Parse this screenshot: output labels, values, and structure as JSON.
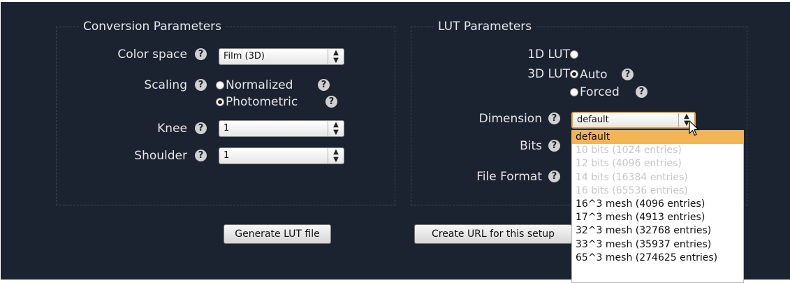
{
  "conversion": {
    "legend": "Conversion Parameters",
    "color_space": {
      "label": "Color space",
      "value": "Film (3D)"
    },
    "scaling": {
      "label": "Scaling",
      "options": [
        "Normalized",
        "Photometric"
      ],
      "selected": "Photometric"
    },
    "knee": {
      "label": "Knee",
      "value": "1"
    },
    "shoulder": {
      "label": "Shoulder",
      "value": "1"
    }
  },
  "lut": {
    "legend": "LUT Parameters",
    "lut1d": {
      "label": "1D LUT",
      "selected": false
    },
    "lut3d": {
      "label": "3D LUT",
      "selected": true,
      "options": [
        "Auto",
        "Forced"
      ],
      "option_selected": "Auto"
    },
    "dimension": {
      "label": "Dimension",
      "value": "default"
    },
    "bits": {
      "label": "Bits"
    },
    "file_format": {
      "label": "File Format"
    }
  },
  "buttons": {
    "generate": "Generate LUT file",
    "create_url": "Create URL for this setup"
  },
  "dimension_dropdown": {
    "items": [
      {
        "label": "default",
        "state": "highlighted"
      },
      {
        "label": "10 bits (1024 entries)",
        "state": "disabled"
      },
      {
        "label": "12 bits (4096 entries)",
        "state": "disabled"
      },
      {
        "label": "14 bits (16384 entries)",
        "state": "disabled"
      },
      {
        "label": "16 bits (65536 entries)",
        "state": "disabled"
      },
      {
        "label": "16^3 mesh (4096 entries)",
        "state": "enabled"
      },
      {
        "label": "17^3 mesh (4913 entries)",
        "state": "enabled"
      },
      {
        "label": "32^3 mesh (32768 entries)",
        "state": "enabled"
      },
      {
        "label": "33^3 mesh (35937 entries)",
        "state": "enabled"
      },
      {
        "label": "65^3 mesh (274625 entries)",
        "state": "enabled"
      }
    ]
  },
  "icons": {
    "help": "help-question-icon",
    "select_arrows": "up-down-arrows-icon",
    "cursor": "mouse-pointer-icon"
  },
  "colors": {
    "background": "#1b2331",
    "highlight": "#f3b553",
    "focus_border": "#e8a544"
  }
}
